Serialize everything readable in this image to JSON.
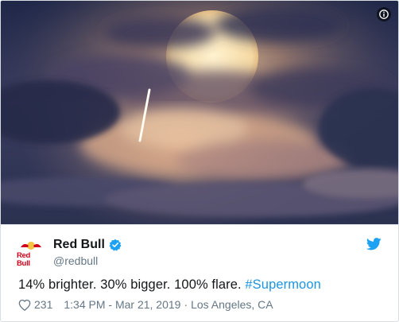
{
  "media": {
    "alt": "Moon behind clouds with a plane contrail"
  },
  "author": {
    "display_name": "Red Bull",
    "handle": "@redbull",
    "avatar_text": "Red Bull",
    "verified": true
  },
  "tweet": {
    "text_plain": "14% brighter. 30% bigger. 100% flare. ",
    "hashtag": "#Supermoon"
  },
  "meta": {
    "like_count": "231",
    "timestamp": "1:34 PM - Mar 21, 2019",
    "separator": "·",
    "location": "Los Angeles, CA"
  },
  "colors": {
    "link": "#1b95e0",
    "text": "#14171a",
    "secondary": "#657786",
    "twitter_blue": "#1da1f2",
    "brand_red": "#d0021b"
  },
  "icons": {
    "info": "info-icon",
    "verified": "verified-badge-icon",
    "twitter": "twitter-bird-icon",
    "heart": "heart-icon"
  }
}
